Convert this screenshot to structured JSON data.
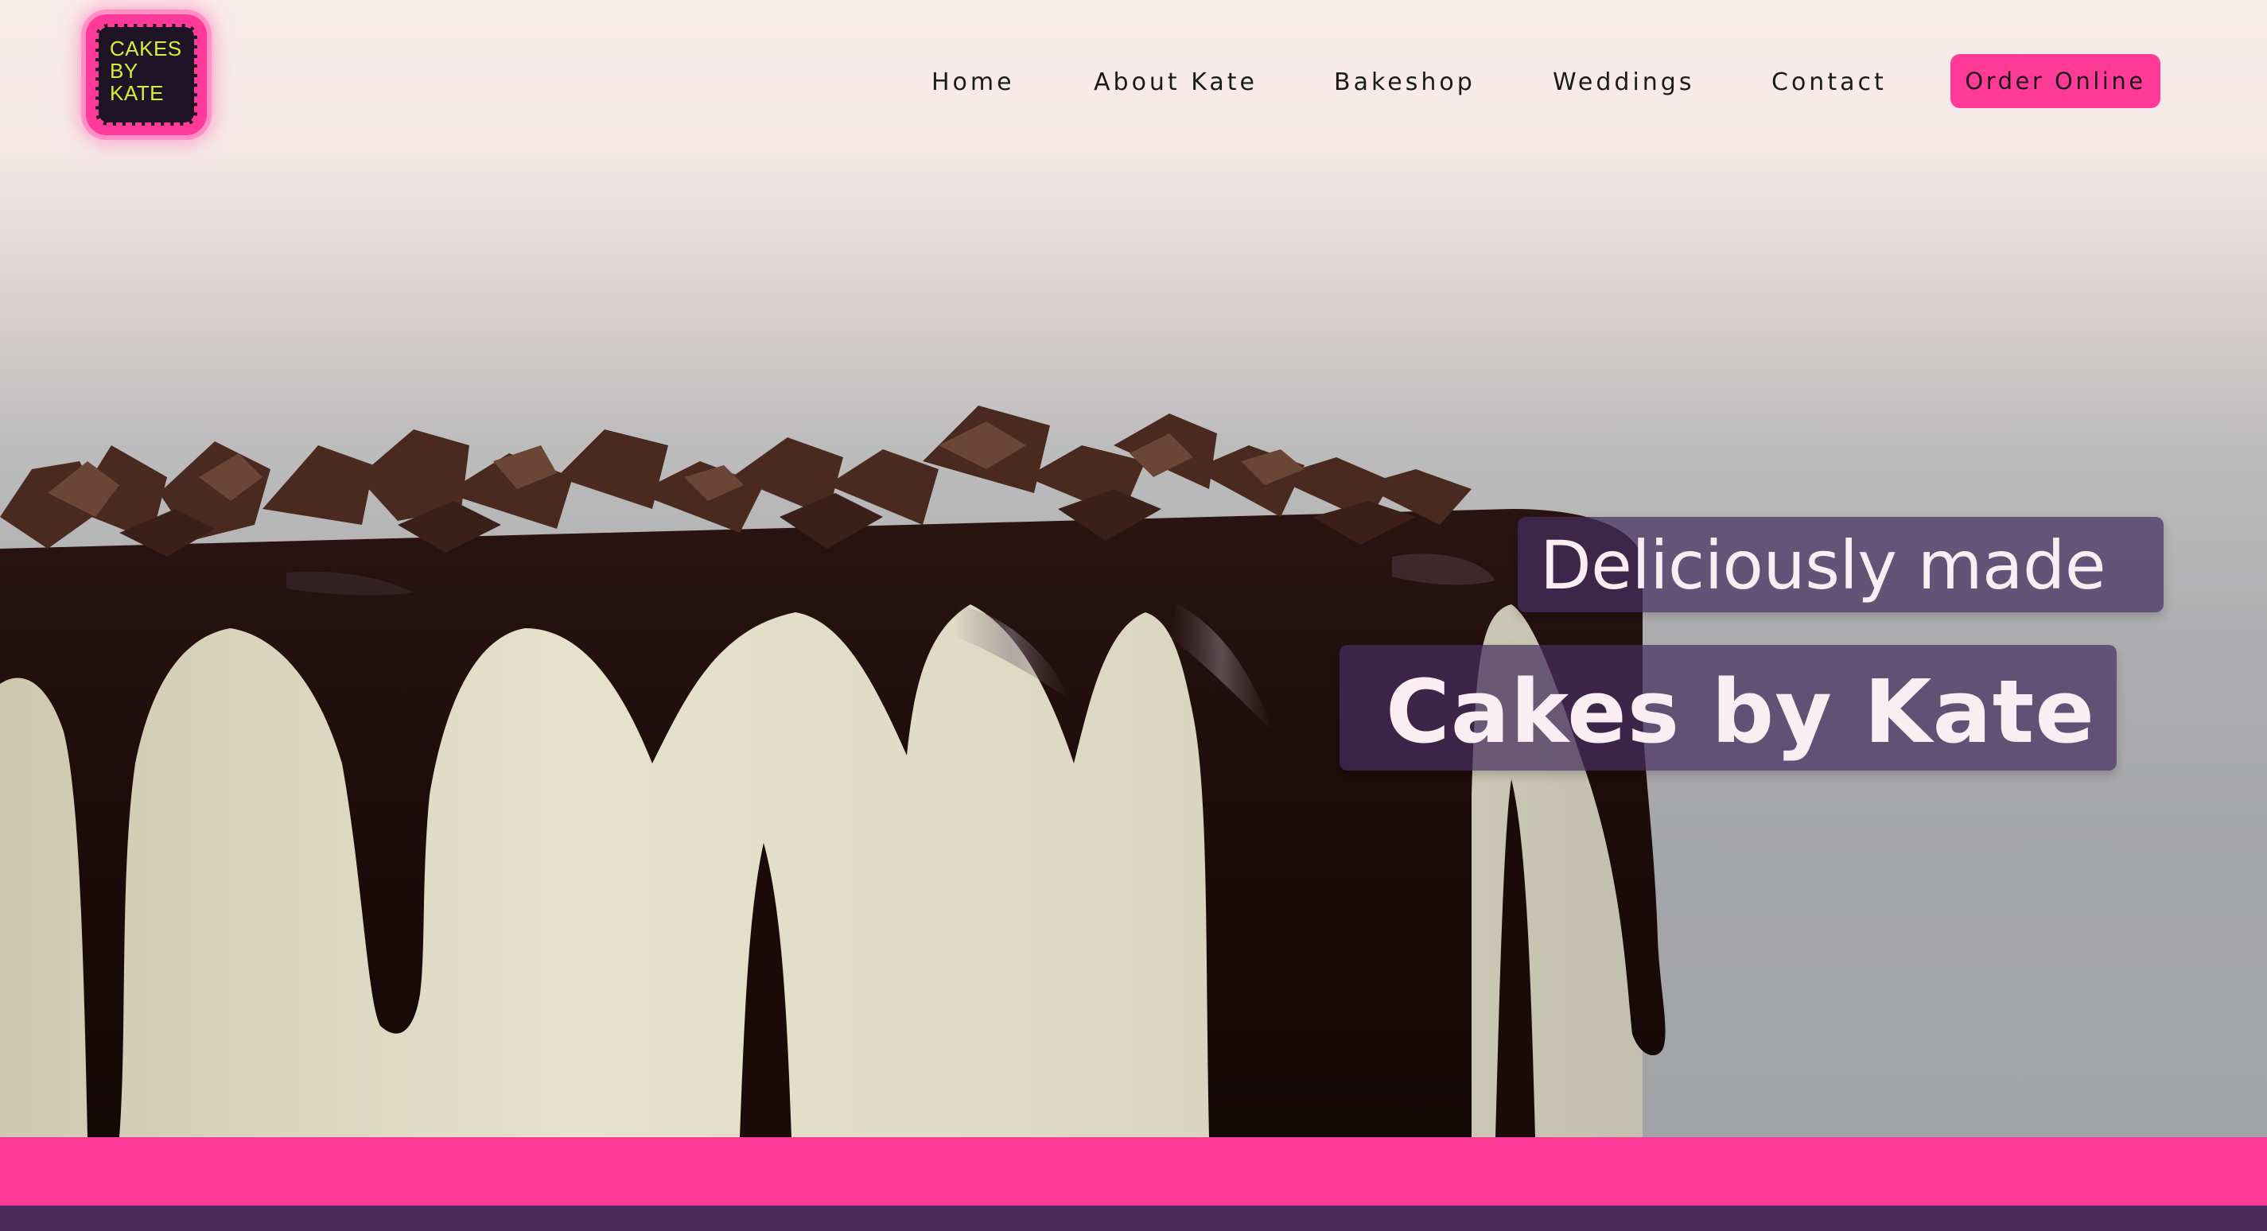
{
  "brand": {
    "logo_lines": [
      "CAKES",
      "BY",
      "KATE"
    ],
    "logo_colors": {
      "frame": "#ff3a9a",
      "inner": "#1f1426",
      "text": "#d9ee3a"
    }
  },
  "nav": {
    "items": [
      {
        "label": "Home"
      },
      {
        "label": "About Kate"
      },
      {
        "label": "Bakeshop"
      },
      {
        "label": "Weddings"
      },
      {
        "label": "Contact"
      }
    ],
    "cta": {
      "label": "Order Online",
      "color": "#ff3a97"
    }
  },
  "hero": {
    "tagline": "Deliciously made",
    "title": "Cakes by Kate",
    "image": "chocolate-drip-cake",
    "box_color": "#462e60"
  },
  "footer_bands": {
    "pink": "#ff3a97",
    "purple": "#4c2a5c"
  }
}
